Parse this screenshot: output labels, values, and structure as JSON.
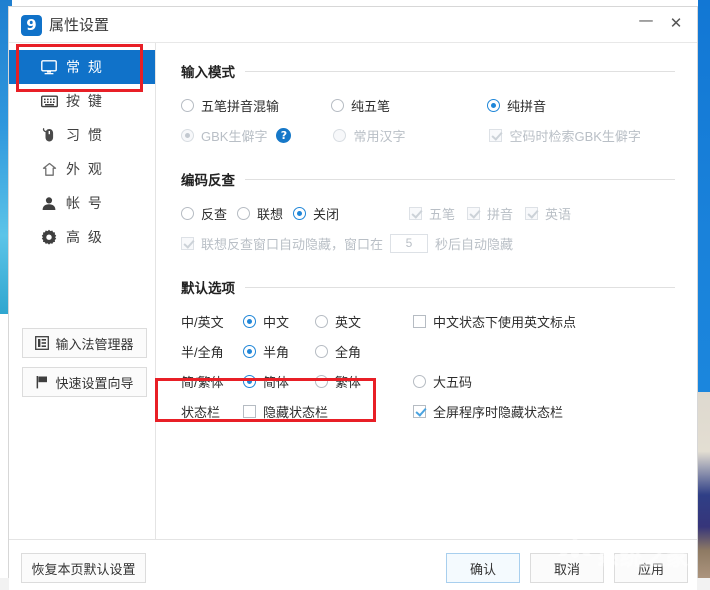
{
  "window": {
    "title": "属性设置",
    "logo_text": "9",
    "minimize_label": "—",
    "close_label": "✕"
  },
  "sidebar": {
    "items": [
      {
        "label": "常 规",
        "icon": "monitor-icon",
        "active": true
      },
      {
        "label": "按 键",
        "icon": "keyboard-icon",
        "active": false
      },
      {
        "label": "习 惯",
        "icon": "mouse-icon",
        "active": false
      },
      {
        "label": "外 观",
        "icon": "shirt-icon",
        "active": false
      },
      {
        "label": "帐 号",
        "icon": "person-icon",
        "active": false
      },
      {
        "label": "高 级",
        "icon": "gear-icon",
        "active": false
      }
    ],
    "buttons": [
      {
        "label": "输入法管理器",
        "icon": "list-panel-icon"
      },
      {
        "label": "快速设置向导",
        "icon": "flag-icon"
      }
    ]
  },
  "groups": {
    "input_mode": {
      "title": "输入模式",
      "row1": [
        {
          "label": "五笔拼音混输",
          "type": "radio",
          "checked": false,
          "disabled": false
        },
        {
          "label": "纯五笔",
          "type": "radio",
          "checked": false,
          "disabled": false
        },
        {
          "label": "纯拼音",
          "type": "radio",
          "checked": true,
          "disabled": false
        }
      ],
      "row2": [
        {
          "label": "GBK生僻字",
          "type": "radio",
          "checked": true,
          "disabled": true
        },
        {
          "label": "常用汉字",
          "type": "radio",
          "checked": false,
          "disabled": true
        },
        {
          "label": "空码时检索GBK生僻字",
          "type": "check",
          "checked": true,
          "disabled": true
        }
      ],
      "help_badge": "?"
    },
    "encoding_lookup": {
      "title": "编码反查",
      "row1": [
        {
          "label": "反查",
          "type": "radio",
          "checked": false,
          "disabled": false
        },
        {
          "label": "联想",
          "type": "radio",
          "checked": false,
          "disabled": false
        },
        {
          "label": "关闭",
          "type": "radio",
          "checked": true,
          "disabled": false
        }
      ],
      "row1b": [
        {
          "label": "五笔",
          "type": "check",
          "checked": true,
          "disabled": true
        },
        {
          "label": "拼音",
          "type": "check",
          "checked": true,
          "disabled": true
        },
        {
          "label": "英语",
          "type": "check",
          "checked": true,
          "disabled": true
        }
      ],
      "autohide": {
        "prefix_label": "联想反查窗口自动隐藏，窗口在",
        "value": "5",
        "suffix_label": "秒后自动隐藏",
        "checked": true,
        "disabled": true
      }
    },
    "default_options": {
      "title": "默认选项",
      "rows": [
        {
          "label": "中/英文",
          "options": [
            {
              "label": "中文",
              "type": "radio",
              "checked": true
            },
            {
              "label": "英文",
              "type": "radio",
              "checked": false
            }
          ],
          "extra": {
            "label": "中文状态下使用英文标点",
            "type": "check",
            "checked": false
          }
        },
        {
          "label": "半/全角",
          "options": [
            {
              "label": "半角",
              "type": "radio",
              "checked": true
            },
            {
              "label": "全角",
              "type": "radio",
              "checked": false
            }
          ],
          "extra": null
        },
        {
          "label": "简/繁体",
          "options": [
            {
              "label": "简体",
              "type": "radio",
              "checked": true
            },
            {
              "label": "繁体",
              "type": "radio",
              "checked": false
            }
          ],
          "extra": {
            "label": "大五码",
            "type": "radio",
            "checked": false
          }
        },
        {
          "label": "状态栏",
          "options": [
            {
              "label": "隐藏状态栏",
              "type": "check",
              "checked": false
            }
          ],
          "extra": {
            "label": "全屏程序时隐藏状态栏",
            "type": "check",
            "checked": true
          }
        }
      ]
    }
  },
  "footer": {
    "restore_defaults": "恢复本页默认设置",
    "ok": "确认",
    "cancel": "取消",
    "apply": "应用"
  },
  "watermark": {
    "text": "系统之家"
  },
  "colors": {
    "accent_blue": "#1072c9",
    "highlight_red": "#e81f26",
    "radio_blue": "#1f86d8",
    "check_blue": "#4aa3e0"
  }
}
